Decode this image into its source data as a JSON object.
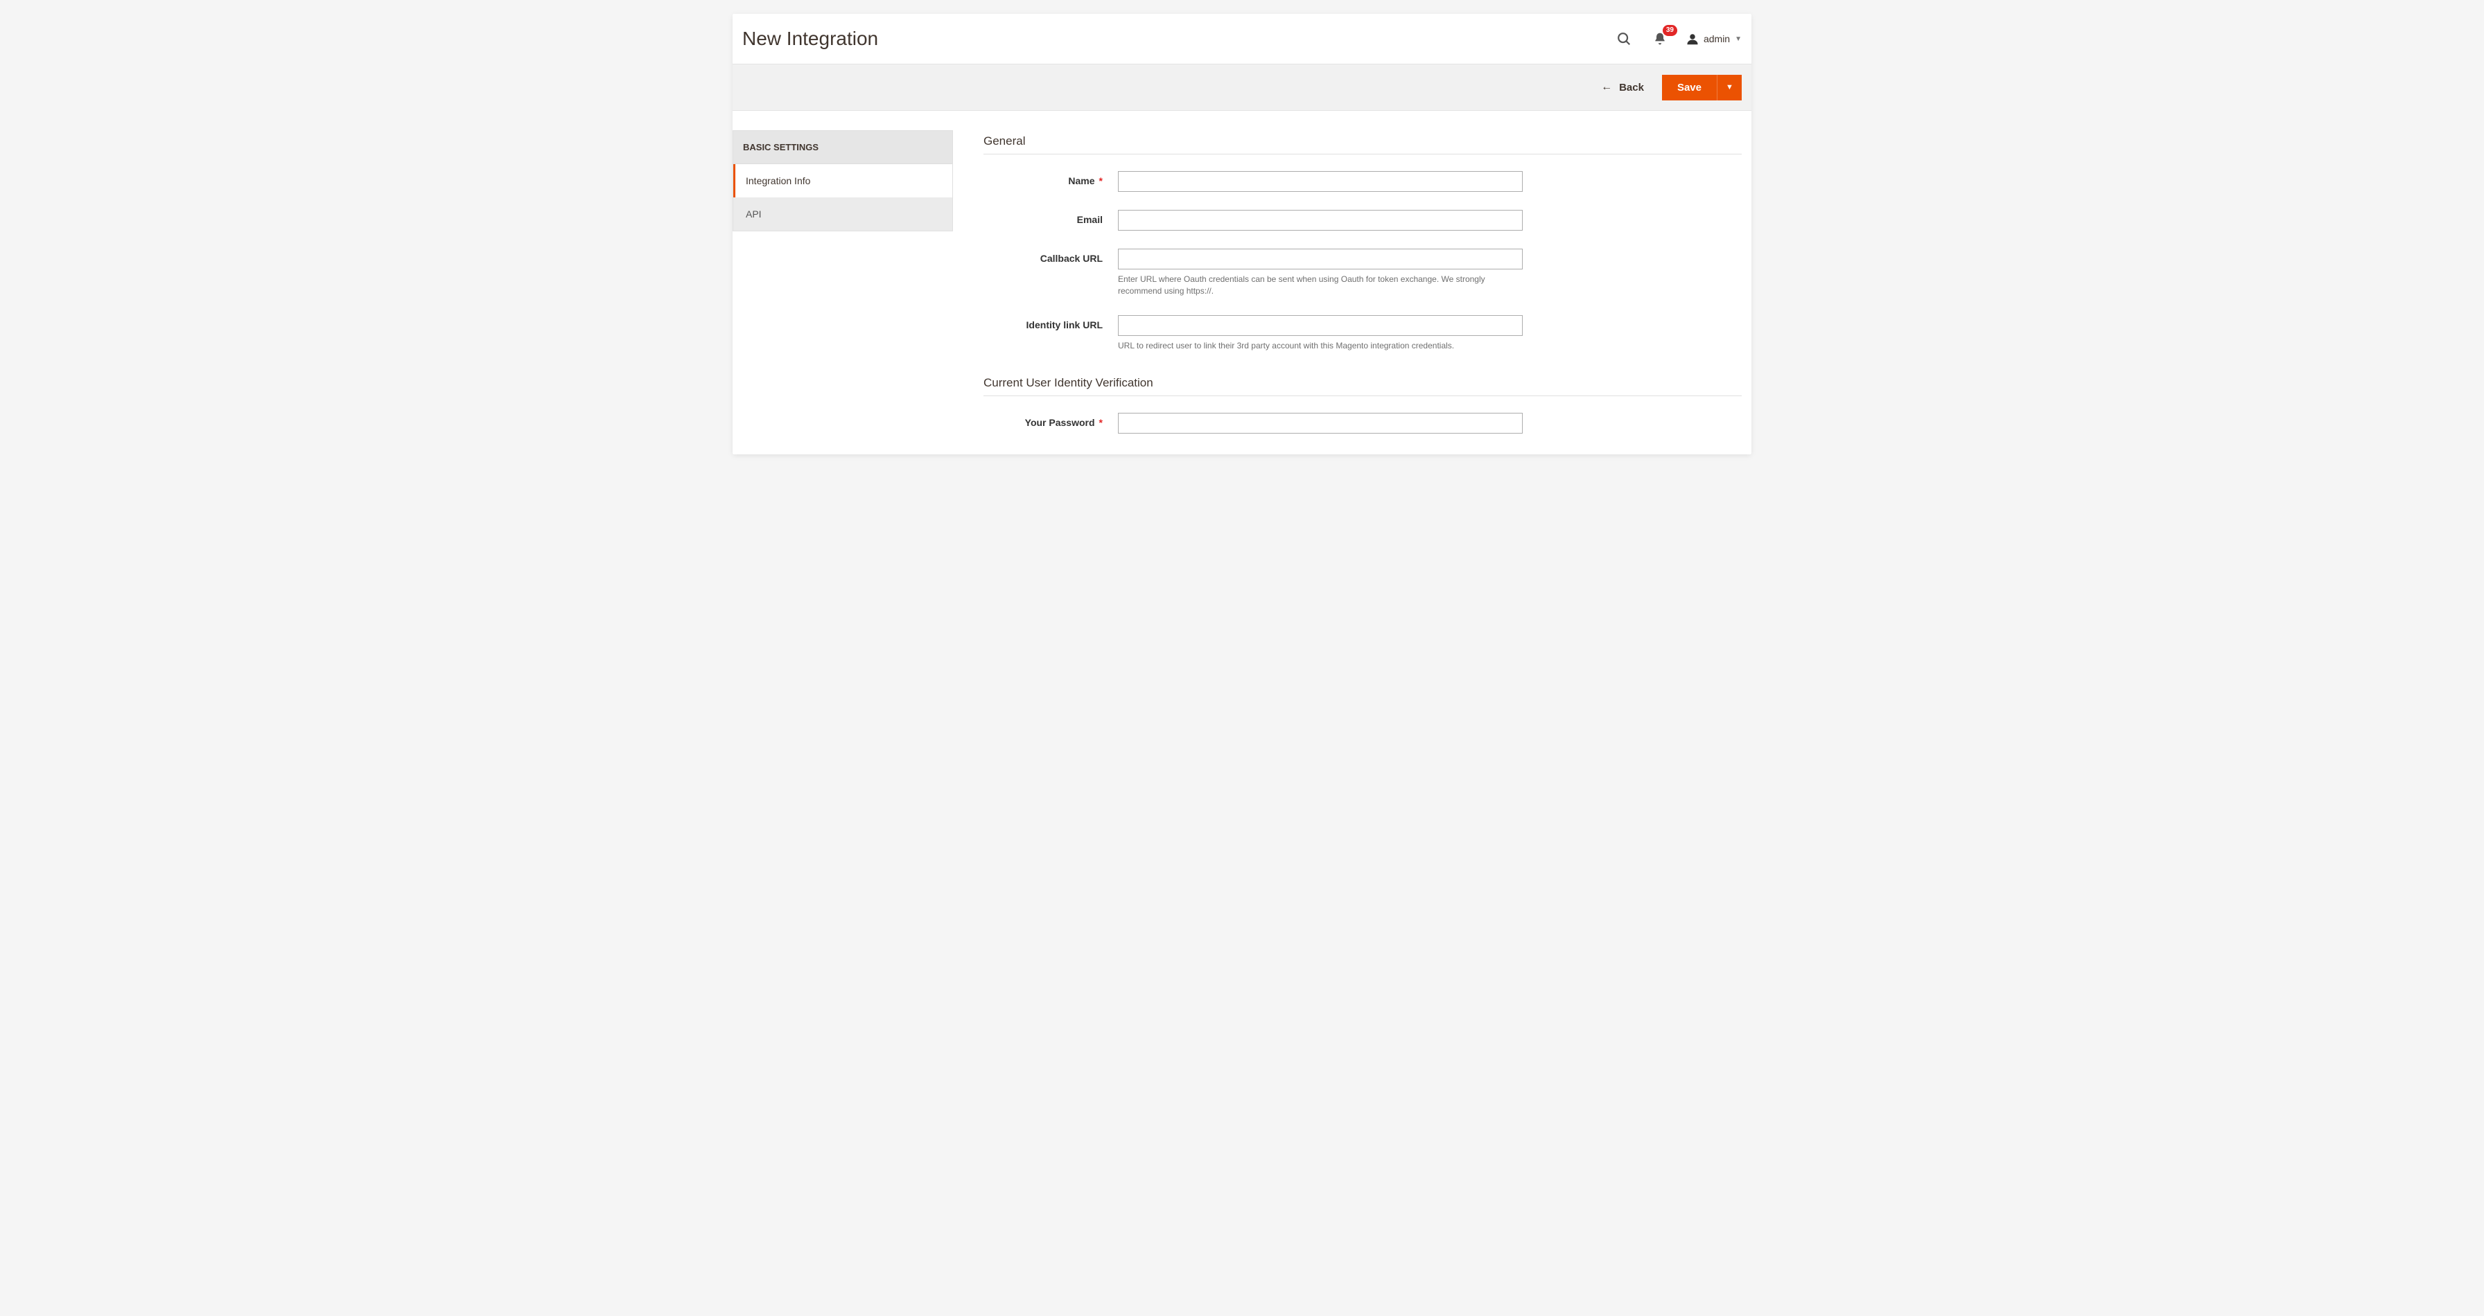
{
  "header": {
    "title": "New Integration",
    "notification_count": "39",
    "username": "admin"
  },
  "actions": {
    "back_label": "Back",
    "save_label": "Save"
  },
  "sidebar": {
    "title": "BASIC SETTINGS",
    "tabs": [
      {
        "label": "Integration Info",
        "active": true
      },
      {
        "label": "API",
        "active": false
      }
    ]
  },
  "form": {
    "sections": [
      {
        "legend": "General",
        "fields": [
          {
            "key": "name",
            "label": "Name",
            "required": true,
            "value": "",
            "note": null
          },
          {
            "key": "email",
            "label": "Email",
            "required": false,
            "value": "",
            "note": null
          },
          {
            "key": "callback_url",
            "label": "Callback URL",
            "required": false,
            "value": "",
            "note": "Enter URL where Oauth credentials can be sent when using Oauth for token exchange. We strongly recommend using https://."
          },
          {
            "key": "identity_link_url",
            "label": "Identity link URL",
            "required": false,
            "value": "",
            "note": "URL to redirect user to link their 3rd party account with this Magento integration credentials."
          }
        ]
      },
      {
        "legend": "Current User Identity Verification",
        "fields": [
          {
            "key": "current_password",
            "label": "Your Password",
            "required": true,
            "value": "",
            "note": null,
            "type": "password"
          }
        ]
      }
    ]
  }
}
